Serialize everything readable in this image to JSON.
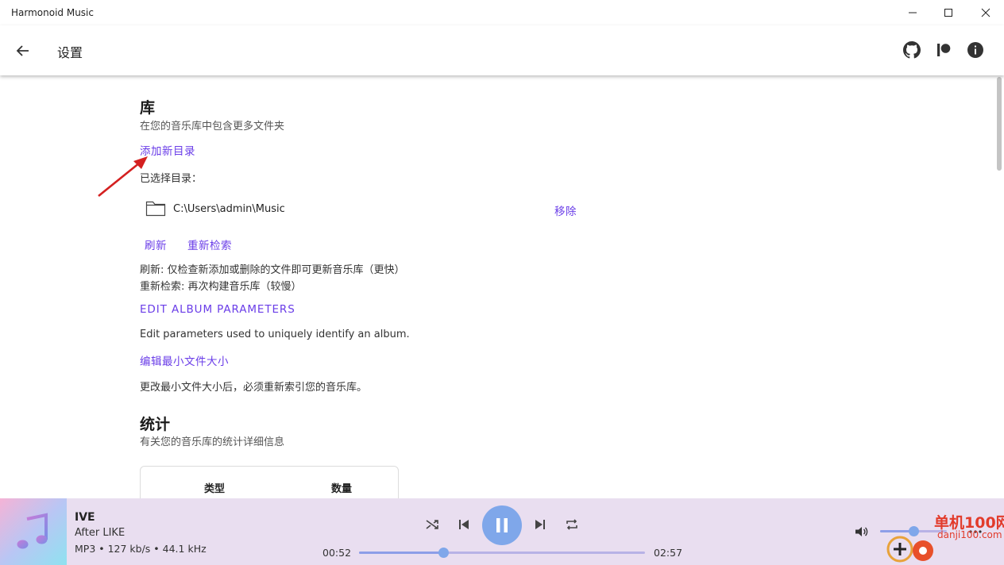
{
  "window": {
    "title": "Harmonoid Music"
  },
  "appbar": {
    "title": "设置"
  },
  "library": {
    "heading": "库",
    "subtitle": "在您的音乐库中包含更多文件夹",
    "add_dir_label": "添加新目录",
    "selected_label": "已选择目录：",
    "folders": [
      {
        "path": "C:\\Users\\admin\\Music",
        "remove_label": "移除"
      }
    ],
    "refresh_label": "刷新",
    "reindex_label": "重新检索",
    "refresh_desc": "刷新: 仅检查新添加或删除的文件即可更新音乐库（更快）",
    "reindex_desc": "重新检索: 再次构建音乐库（较慢）",
    "edit_album_label": "EDIT ALBUM PARAMETERS",
    "edit_album_desc": "Edit parameters used to uniquely identify an album.",
    "edit_min_size_label": "编辑最小文件大小",
    "edit_min_size_desc": "更改最小文件大小后，必须重新索引您的音乐库。"
  },
  "stats": {
    "heading": "统计",
    "subtitle": "有关您的音乐库的统计详细信息",
    "columns": [
      "类型",
      "数量"
    ]
  },
  "player": {
    "title": "IVE",
    "subtitle": "After LIKE",
    "meta": "MP3 • 127 kb/s • 44.1 kHz",
    "position": "00:52",
    "duration": "02:57",
    "progress_fraction": 0.294,
    "volume_fraction": 0.5
  },
  "watermark": {
    "site": "单机100网",
    "url": "danji100.com"
  },
  "colors": {
    "accent": "#6a3de8",
    "player_bg": "#e9def0",
    "play_button": "#7fa7ea"
  }
}
